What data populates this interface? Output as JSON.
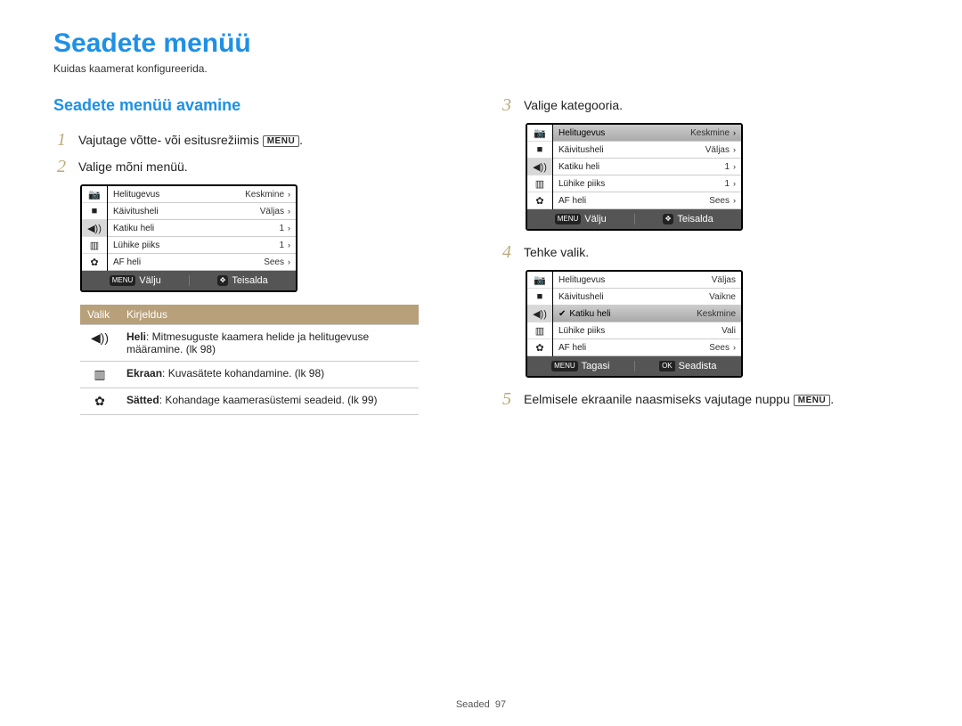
{
  "title": "Seadete menüü",
  "subtitle": "Kuidas kaamerat konfigureerida.",
  "left": {
    "section": "Seadete menüü avamine",
    "step1_a": "Vajutage võtte- või esitusrežiimis ",
    "step1_btn": "MENU",
    "step1_b": ".",
    "step2": "Valige mõni menüü."
  },
  "cam_common": {
    "left_exit": "Välju",
    "right_move": "Teisalda",
    "left_back": "Tagasi",
    "right_set": "Seadista",
    "menu_pill": "MENU",
    "ok_pill": "OK",
    "nav_pill": "✥"
  },
  "cam1_rows": [
    {
      "lab": "Helitugevus",
      "val": "Keskmine"
    },
    {
      "lab": "Käivitusheli",
      "val": "Väljas"
    },
    {
      "lab": "Katiku heli",
      "val": "1"
    },
    {
      "lab": "Lühike piiks",
      "val": "1"
    },
    {
      "lab": "AF heli",
      "val": "Sees"
    }
  ],
  "desc_table": {
    "h1": "Valik",
    "h2": "Kirjeldus",
    "rows": [
      {
        "icon": "◀))",
        "bold": "Heli",
        "text": ": Mitmesuguste kaamera helide ja helitugevuse määramine. (lk 98)"
      },
      {
        "icon": "▥",
        "bold": "Ekraan",
        "text": ": Kuvasätete kohandamine. (lk 98)"
      },
      {
        "icon": "✿",
        "bold": "Sätted",
        "text": ": Kohandage kaamerasüstemi seadeid. (lk 99)"
      }
    ]
  },
  "right": {
    "step3": "Valige kategooria.",
    "step4": "Tehke valik.",
    "step5_a": "Eelmisele ekraanile naasmiseks vajutage nuppu ",
    "step5_btn": "MENU",
    "step5_b": "."
  },
  "cam3_rows": [
    {
      "lab": "Helitugevus",
      "val": "Väljas"
    },
    {
      "lab": "Käivitusheli",
      "val": "Vaikne"
    },
    {
      "lab": "Katiku heli",
      "val": "Keskmine",
      "sel": true,
      "chk": true
    },
    {
      "lab": "Lühike piiks",
      "val": "Vali"
    },
    {
      "lab": "AF heli",
      "val": "Sees",
      "chev": true
    }
  ],
  "footer_label": "Seaded",
  "footer_page": "97",
  "icons": {
    "cam": "📷",
    "vid": "■",
    "snd": "◀))",
    "scr": "▥",
    "gear": "✿"
  }
}
